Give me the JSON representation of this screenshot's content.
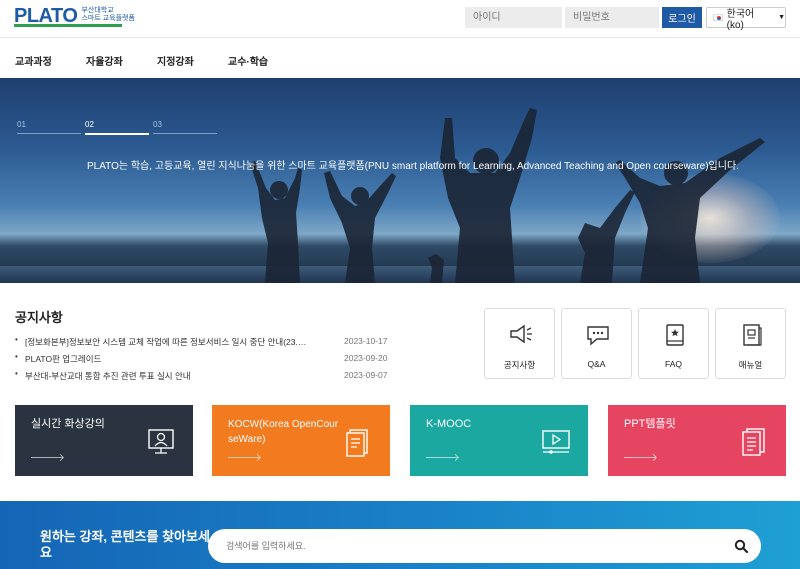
{
  "header": {
    "logo_main": "PLATO",
    "logo_sub_1": "부산대학교",
    "logo_sub_2": "스마트 교육플랫폼",
    "id_placeholder": "아이디",
    "pw_placeholder": "비밀번호",
    "login_label": "로그인",
    "language": "한국어 (ko)"
  },
  "nav": {
    "items": [
      "교과과정",
      "자율강좌",
      "지정강좌",
      "교수·학습"
    ]
  },
  "hero": {
    "steps": [
      "01",
      "02",
      "03"
    ],
    "active_step": "02",
    "text": "PLATO는 학습, 고등교육, 열린 지식나눔을 위한 스마트 교육플랫폼(PNU smart platform for Learning, Advanced Teaching and Open courseware)입니다."
  },
  "notices": {
    "title": "공지사항",
    "items": [
      {
        "text": "[정보화본부]정보보안 시스템 교체 작업에 따른 정보서비스 일시 중단 안내(23.…",
        "date": "2023-10-17"
      },
      {
        "text": "PLATO판 업그레이드",
        "date": "2023-09-20"
      },
      {
        "text": "부산대-부산교대 통합 추진 관련 투표 실시 안내",
        "date": "2023-09-07"
      }
    ]
  },
  "quick_links": [
    {
      "label": "공지사항",
      "icon": "megaphone-icon"
    },
    {
      "label": "Q&A",
      "icon": "chat-bubble-icon"
    },
    {
      "label": "FAQ",
      "icon": "book-icon"
    },
    {
      "label": "매뉴얼",
      "icon": "manual-icon"
    }
  ],
  "cards": [
    {
      "title": "실시간 화상강의",
      "color": "#2b3340",
      "icon": "webcam-user-icon"
    },
    {
      "title": "KOCW(Korea OpenCourseWare)",
      "color": "#f27a1f",
      "icon": "document-icon"
    },
    {
      "title": "K-MOOC",
      "color": "#1aa8a0",
      "icon": "video-player-icon"
    },
    {
      "title": "PPT템플릿",
      "color": "#e64561",
      "icon": "slides-icon"
    }
  ],
  "search": {
    "title": "원하는 강좌, 콘텐츠를 찾아보세요",
    "placeholder": "검색어를 입력하세요."
  }
}
